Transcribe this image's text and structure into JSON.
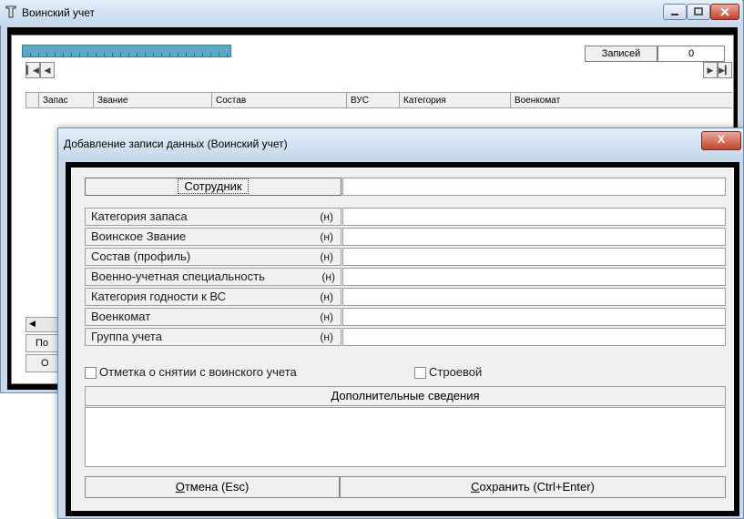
{
  "main_window": {
    "title": "Воинский учет",
    "records_label": "Записей",
    "records_count": "0",
    "columns": [
      "Запас",
      "Звание",
      "Состав",
      "ВУС",
      "Категория",
      "Военкомат"
    ],
    "under_button_1": "По",
    "under_button_2": "О"
  },
  "dialog": {
    "title": "Добавление записи данных  (Воинский учет)",
    "close_label": "X",
    "employee_button": "Сотрудник",
    "fields": [
      {
        "label": "Категория запаса",
        "flag": "(н)",
        "value": ""
      },
      {
        "label": "Воинское Звание",
        "flag": "(н)",
        "value": ""
      },
      {
        "label": "Состав (профиль)",
        "flag": "(н)",
        "value": ""
      },
      {
        "label": "Военно-учетная специальность",
        "flag": "(н)",
        "value": ""
      },
      {
        "label": "Категория годности к ВС",
        "flag": "(н)",
        "value": ""
      },
      {
        "label": "Военкомат",
        "flag": "(н)",
        "value": ""
      },
      {
        "label": "Группа учета",
        "flag": "(н)",
        "value": ""
      }
    ],
    "checkbox_removed": {
      "label": "Отметка о снятии с воинского учета",
      "checked": false
    },
    "checkbox_combat": {
      "label": "Строевой",
      "checked": false
    },
    "extra_info_header": "Дополнительные сведения",
    "extra_info_value": "",
    "cancel_button": {
      "underlined": "О",
      "rest": "тмена (Esc)"
    },
    "save_button": {
      "underlined": "С",
      "rest": "охранить (Ctrl+Enter)"
    }
  },
  "colors": {
    "titlebar": "#c8d9ec",
    "progress": "#5aaac7",
    "close": "#c2432c"
  }
}
